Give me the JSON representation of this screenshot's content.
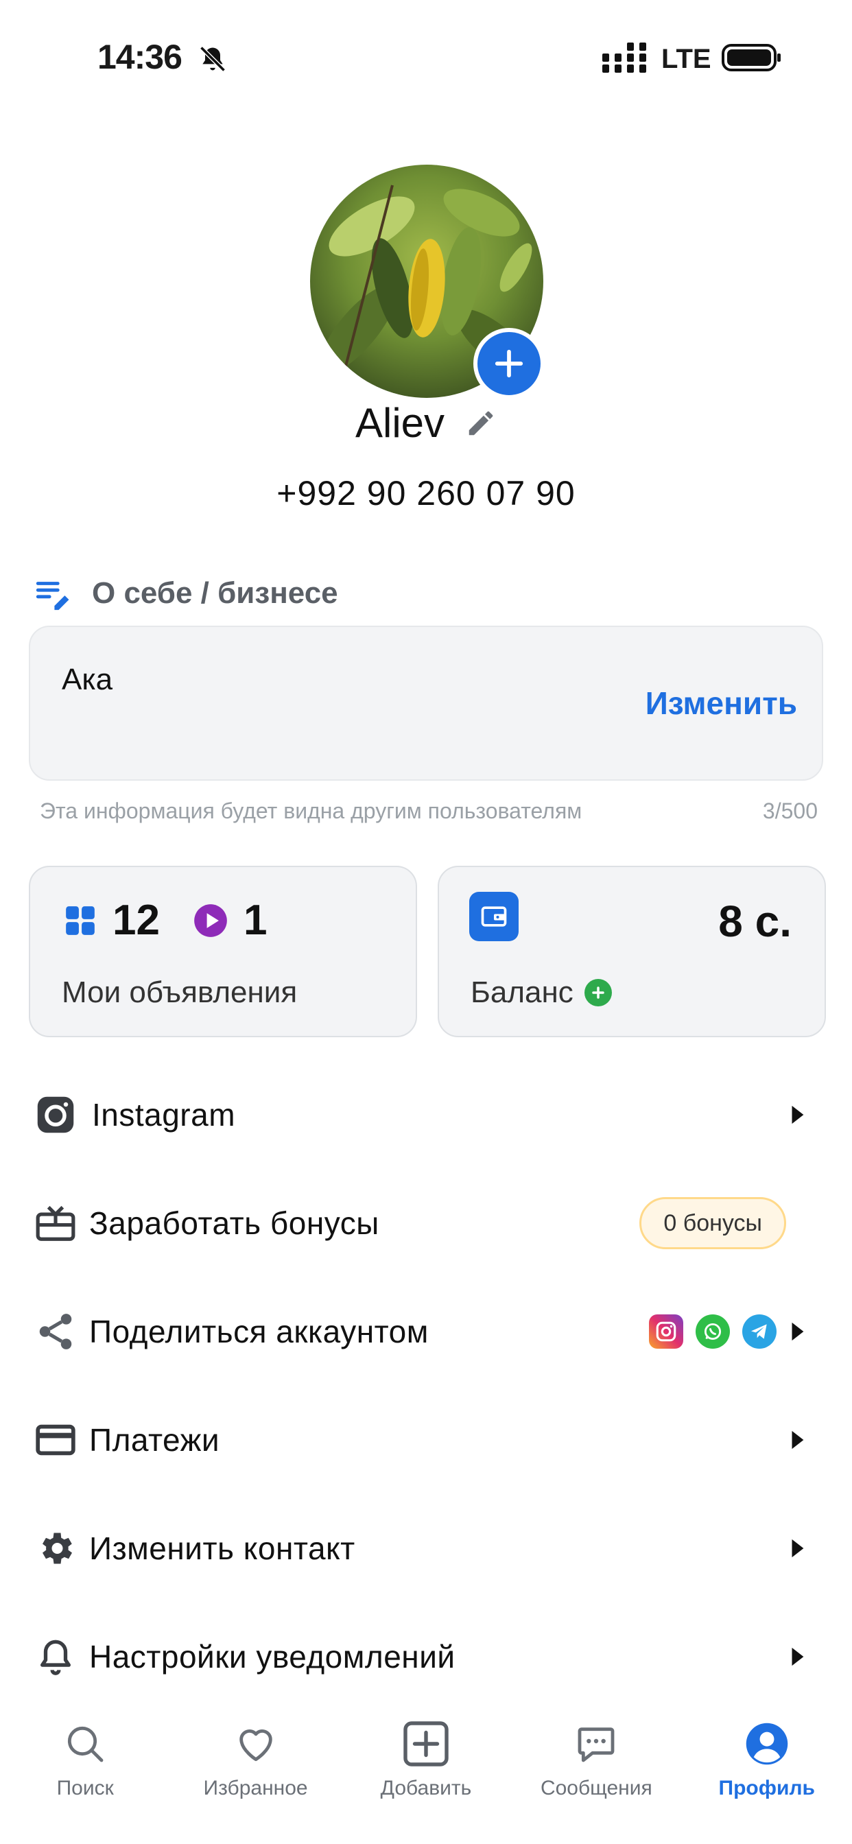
{
  "status_bar": {
    "time": "14:36",
    "network": "LTE"
  },
  "profile": {
    "name": "Aliev",
    "phone": "+992 90 260 07 90"
  },
  "about": {
    "heading": "О себе / бизнесе",
    "text": "Ака",
    "edit_label": "Изменить",
    "hint": "Эта информация будет видна другим пользователям",
    "counter": "3/500"
  },
  "stats": {
    "ads_count": "12",
    "video_count": "1",
    "ads_label": "Мои объявления",
    "balance_value": "8 с.",
    "balance_label": "Баланс"
  },
  "menu": {
    "instagram": "Instagram",
    "bonuses": "Заработать бонусы",
    "bonuses_badge": "0 бонусы",
    "share": "Поделиться аккаунтом",
    "payments": "Платежи",
    "change_contact": "Изменить контакт",
    "notifications": "Настройки уведомлений"
  },
  "tabs": {
    "search": "Поиск",
    "favorites": "Избранное",
    "add": "Добавить",
    "messages": "Сообщения",
    "profile": "Профиль"
  },
  "colors": {
    "accent": "#1f6fe0",
    "text": "#111111",
    "muted": "#9aa0a6",
    "card": "#f3f4f6",
    "green": "#2eaa4c",
    "purple": "#8e2bb8"
  }
}
